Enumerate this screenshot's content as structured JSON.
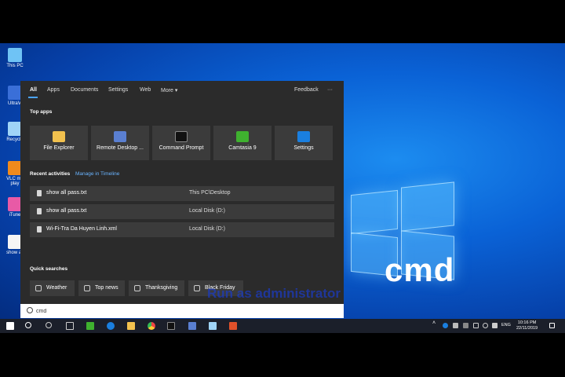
{
  "desktop": {
    "icons": [
      {
        "label": "This PC"
      },
      {
        "label": "UltraVi"
      },
      {
        "label": "Recycle"
      },
      {
        "label": "VLC me play"
      },
      {
        "label": "iTune"
      },
      {
        "label": "show all"
      }
    ],
    "overlay_text": "cmd",
    "run_as_admin_text": "Run as administrator"
  },
  "start": {
    "tabs": [
      "All",
      "Apps",
      "Documents",
      "Settings",
      "Web",
      "More"
    ],
    "feedback": "Feedback",
    "ellipsis": "···",
    "top_apps_title": "Top apps",
    "top_apps": [
      {
        "label": "File Explorer",
        "icon": "folder-icon",
        "color": "#f2c14e"
      },
      {
        "label": "Remote Desktop ...",
        "icon": "remote-desktop-icon",
        "color": "#5a7fd1"
      },
      {
        "label": "Command Prompt",
        "icon": "terminal-icon",
        "color": "#111111"
      },
      {
        "label": "Camtasia 9",
        "icon": "camtasia-icon",
        "color": "#3fb12f"
      },
      {
        "label": "Settings",
        "icon": "gear-icon",
        "color": "#1a7fe0"
      }
    ],
    "recent_title": "Recent activities",
    "manage_timeline": "Manage in Timeline",
    "recent": [
      {
        "name": "show all pass.txt",
        "location": "This PC\\Desktop"
      },
      {
        "name": "show all pass.txt",
        "location": "Local Disk (D:)"
      },
      {
        "name": "Wi-Fi-Tra Da Huyen Linh.xml",
        "location": "Local Disk (D:)"
      }
    ],
    "quick_title": "Quick searches",
    "quick": [
      "Weather",
      "Top news",
      "Thanksgiving",
      "Black Friday"
    ]
  },
  "search": {
    "value": "cmd"
  },
  "taskbar": {
    "language": "ENG",
    "time": "10:16 PM",
    "date": "22/11/2019"
  }
}
